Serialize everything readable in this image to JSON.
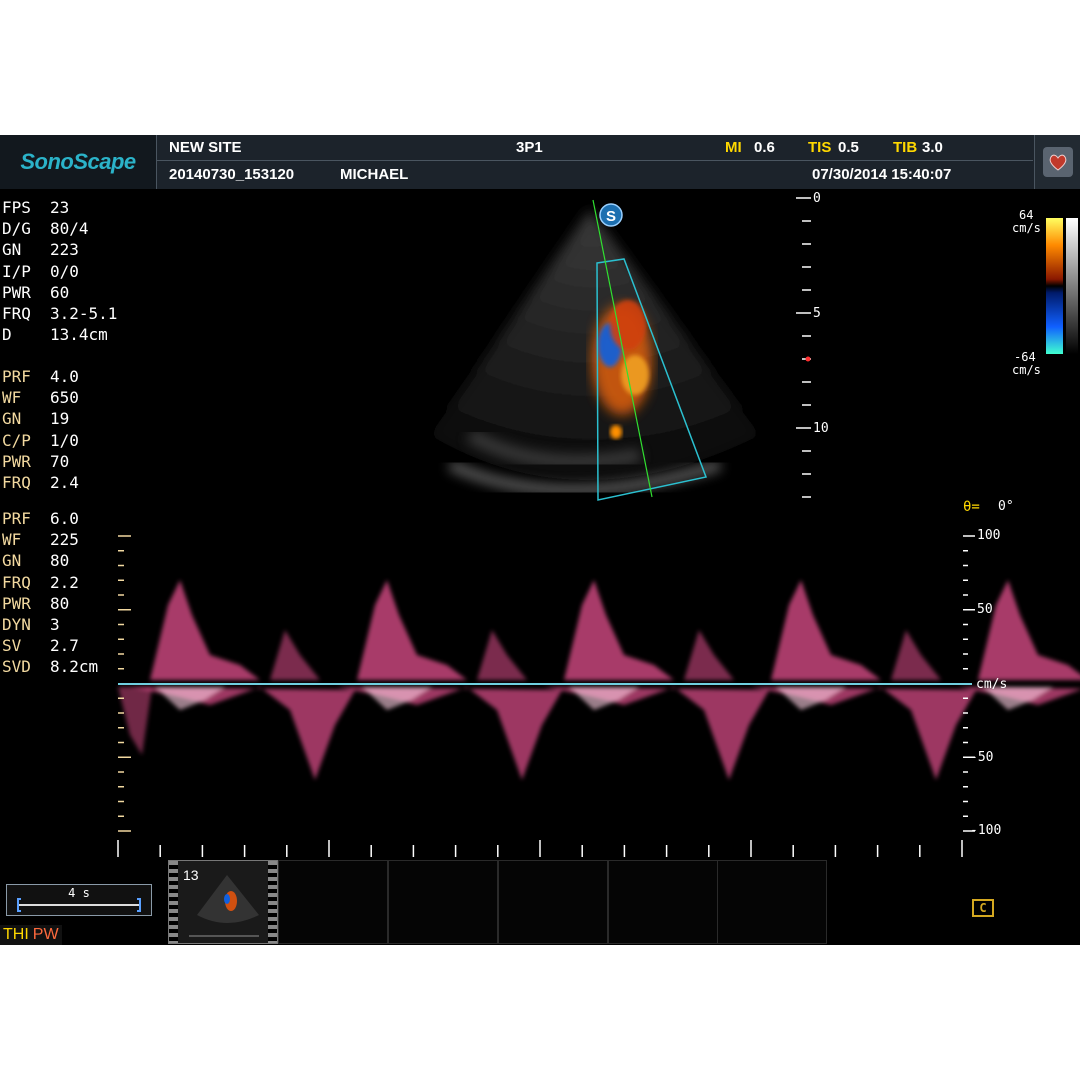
{
  "header": {
    "logo": "SonoScape",
    "site": "NEW SITE",
    "probe": "3P1",
    "mi_label": "MI",
    "mi_value": "0.6",
    "tis_label": "TIS",
    "tis_value": "0.5",
    "tib_label": "TIB",
    "tib_value": "3.0",
    "exam_id": "20140730_153120",
    "patient": "MICHAEL",
    "datetime": "07/30/2014 15:40:07"
  },
  "bmode_params": [
    {
      "key": "FPS",
      "value": "23"
    },
    {
      "key": "D/G",
      "value": "80/4"
    },
    {
      "key": "GN",
      "value": "223"
    },
    {
      "key": "I/P",
      "value": "0/0"
    },
    {
      "key": "PWR",
      "value": "60"
    },
    {
      "key": "FRQ",
      "value": "3.2-5.1"
    },
    {
      "key": "D",
      "value": "13.4cm"
    }
  ],
  "color_params": [
    {
      "key": "PRF",
      "value": "4.0"
    },
    {
      "key": "WF",
      "value": "650"
    },
    {
      "key": "GN",
      "value": "19"
    },
    {
      "key": "C/P",
      "value": "1/0"
    },
    {
      "key": "PWR",
      "value": "70"
    },
    {
      "key": "FRQ",
      "value": "2.4"
    }
  ],
  "pw_params": [
    {
      "key": "PRF",
      "value": "6.0"
    },
    {
      "key": "WF",
      "value": "225"
    },
    {
      "key": "GN",
      "value": "80"
    },
    {
      "key": "FRQ",
      "value": "2.2"
    },
    {
      "key": "PWR",
      "value": "80"
    },
    {
      "key": "DYN",
      "value": "3"
    },
    {
      "key": "SV",
      "value": "2.7"
    },
    {
      "key": "SVD",
      "value": "8.2cm"
    }
  ],
  "depth_scale": {
    "labels": [
      "0",
      "5",
      "10"
    ]
  },
  "color_scale": {
    "top": "64",
    "bottom": "-64",
    "unit": "cm/s"
  },
  "angle": {
    "label": "θ=",
    "value": "0°"
  },
  "velocity_scale": {
    "labels": [
      "100",
      "50",
      "cm/s",
      "-50",
      "-100"
    ]
  },
  "time_bar": {
    "label": "4 s"
  },
  "mode_labels": {
    "thi": "THI",
    "pw": "PW"
  },
  "thumbnail": {
    "number": "13"
  },
  "steer_icon_letter": "S",
  "cine_icon_letter": "C",
  "colors": {
    "accent_cyan": "#2bb3c9",
    "doppler_pink": "#e0508c",
    "baseline": "#6fd0e0",
    "label_yellow": "#ffd800",
    "param_tan": "#f2d9a0"
  },
  "icons": [
    "heart-icon",
    "steer-icon",
    "cine-icon"
  ]
}
